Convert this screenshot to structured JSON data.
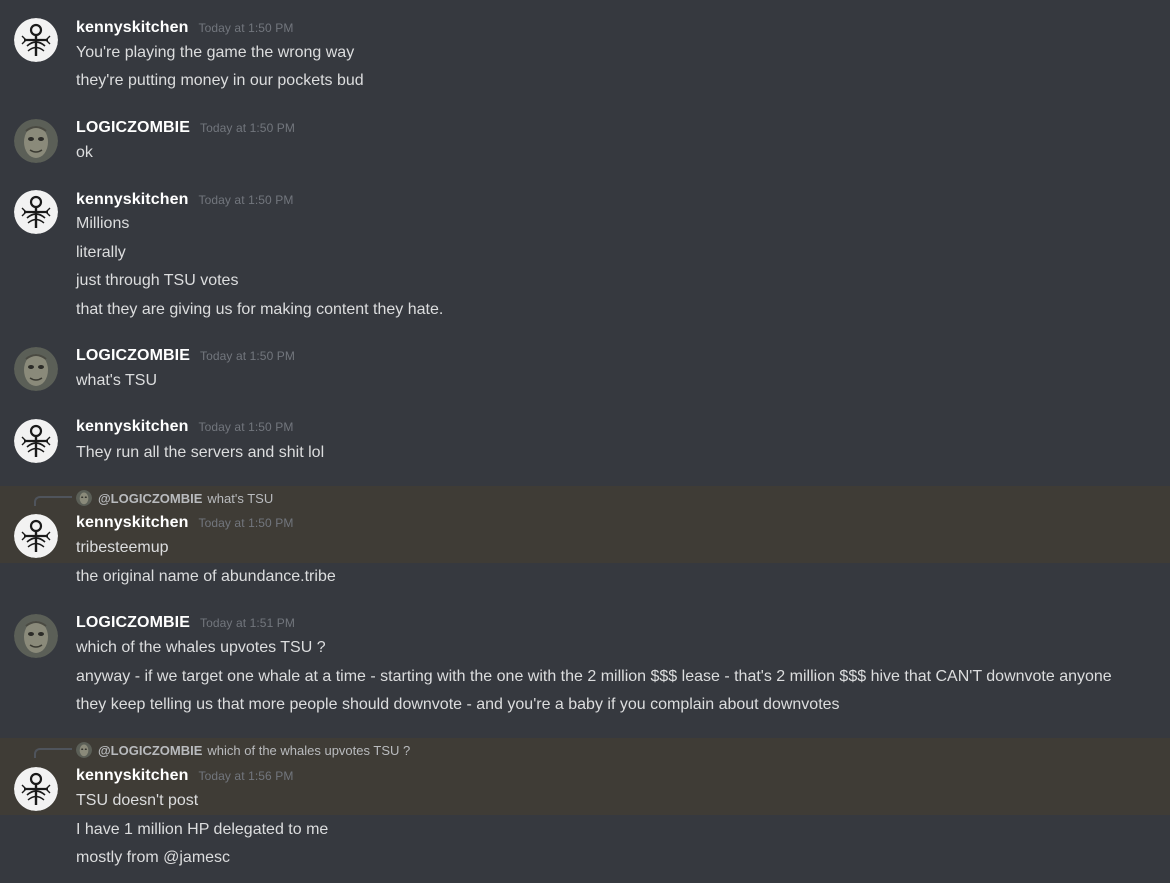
{
  "colors": {
    "background": "#36393f",
    "mention_background": "#3f3c36",
    "username": "#ffffff",
    "text": "#dcddde",
    "timestamp": "#72767d"
  },
  "messages": [
    {
      "author": "kennyskitchen",
      "timestamp": "Today at 1:50 PM",
      "lines": [
        "You're playing the game the wrong way",
        "they're putting money in our pockets bud"
      ]
    },
    {
      "author": "LOGICZOMBIE",
      "timestamp": "Today at 1:50 PM",
      "lines": [
        "ok"
      ]
    },
    {
      "author": "kennyskitchen",
      "timestamp": "Today at 1:50 PM",
      "lines": [
        "Millions",
        "literally",
        "just through TSU votes",
        "that they are giving us for making content they hate."
      ]
    },
    {
      "author": "LOGICZOMBIE",
      "timestamp": "Today at 1:50 PM",
      "lines": [
        "what's TSU"
      ]
    },
    {
      "author": "kennyskitchen",
      "timestamp": "Today at 1:50 PM",
      "lines": [
        "They run all the servers and shit lol"
      ]
    },
    {
      "reply_to": {
        "author": "@LOGICZOMBIE",
        "text": "what's TSU"
      },
      "author": "kennyskitchen",
      "timestamp": "Today at 1:50 PM",
      "lines": [
        "tribesteemup",
        "the original name of abundance.tribe"
      ]
    },
    {
      "author": "LOGICZOMBIE",
      "timestamp": "Today at 1:51 PM",
      "lines": [
        "which of the whales upvotes TSU ?",
        "anyway - if we target one whale at a time - starting with the one with the 2 million $$$ lease - that's 2 million $$$ hive that CAN'T downvote anyone",
        "they keep telling us that more people should downvote - and you're a baby if you complain about downvotes"
      ]
    },
    {
      "reply_to": {
        "author": "@LOGICZOMBIE",
        "text": "which of the whales upvotes TSU ?"
      },
      "author": "kennyskitchen",
      "timestamp": "Today at 1:56 PM",
      "lines": [
        "TSU doesn't post",
        "I have 1 million HP delegated to me",
        "mostly from @jamesc"
      ]
    }
  ]
}
